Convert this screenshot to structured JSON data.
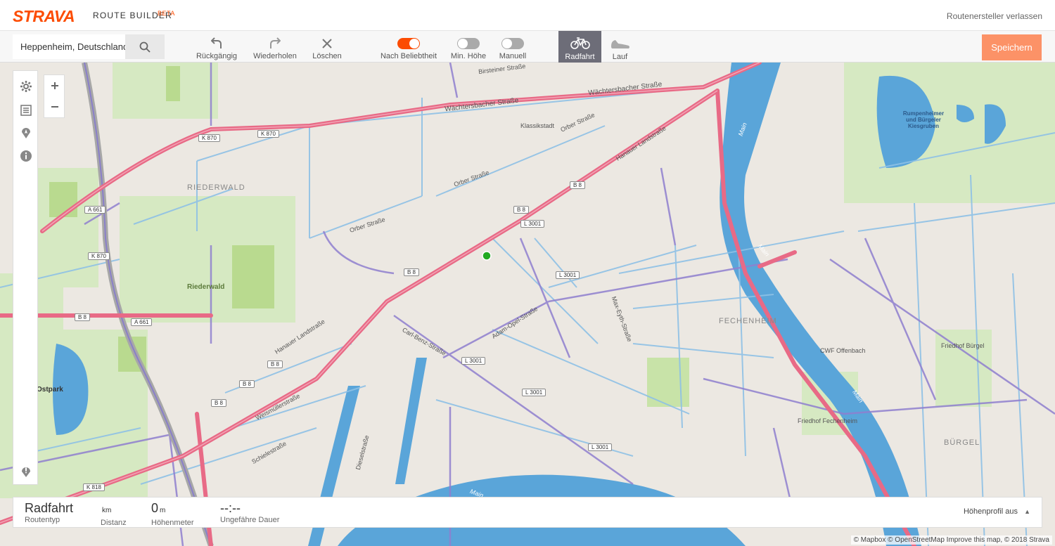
{
  "header": {
    "logo": "STRAVA",
    "title": "ROUTE BUILDER",
    "beta": "BETA",
    "exit": "Routenersteller verlassen"
  },
  "toolbar": {
    "search_value": "Heppenheim, Deutschland",
    "undo": "Rückgängig",
    "redo": "Wiederholen",
    "clear": "Löschen",
    "popularity": "Nach Beliebtheit",
    "min_elevation": "Min. Höhe",
    "manual": "Manuell",
    "ride": "Radfahrt",
    "run": "Lauf",
    "save": "Speichern",
    "popularity_on": true,
    "min_elevation_on": false,
    "manual_on": false,
    "accent": "#fc4c02"
  },
  "map": {
    "labels": {
      "riederwald_district": "RIEDERWALD",
      "riederwald": "Riederwald",
      "fechenheim": "FECHENHEIM",
      "buergel": "BÜRGEL",
      "ostpark": "Ostpark",
      "klassikstadt": "Klassikstadt",
      "lake": "Rumpenheimer und Bürgeler Kiesgruben",
      "cemetery": "Friedhof Fechenheim",
      "cemetery2": "Friedhof Bürgel",
      "cwf": "CWF Offenbach",
      "wachtersbacher": "Wächtersbacher Straße",
      "wachtersbacher2": "Wächtersbacher Straße",
      "hanauer": "Hanauer Landstraße",
      "hanauer2": "Hanauer Landstraße",
      "orber": "Orber Straße",
      "orber2": "Orber Straße",
      "orber3": "Orber Straße",
      "adam_opel": "Adam-Opel-Straße",
      "carl_benz": "Carl-Benz-Straße",
      "max_eyth": "Max-Eyth-Straße",
      "birsteiner": "Birsteiner Straße",
      "weismueller": "Weismüllerstraße",
      "schiele": "Schielestraße",
      "diesel": "Dieselstraße",
      "main1": "Main",
      "main2": "Main",
      "main3": "Main",
      "main4": "Main"
    },
    "roads": {
      "k870a": "K 870",
      "k870b": "K 870",
      "k870c": "K 870",
      "a661a": "A 661",
      "a661b": "A 661",
      "b8a": "B 8",
      "b8b": "B 8",
      "b8c": "B 8",
      "b8d": "B 8",
      "b8e": "B 8",
      "b8f": "B 8",
      "b8g": "B 8",
      "b8h": "B 8",
      "l3001a": "L 3001",
      "l3001b": "L 3001",
      "l3001c": "L 3001",
      "l3001d": "L 3001",
      "l3001e": "L 3001",
      "k818": "K 818"
    }
  },
  "stats": {
    "route_type_value": "Radfahrt",
    "route_type_label": "Routentyp",
    "distance_unit": "km",
    "distance_label": "Distanz",
    "elevation_value": "0",
    "elevation_unit": "m",
    "elevation_label": "Höhenmeter",
    "duration_value": "--:--",
    "duration_label": "Ungefähre Dauer",
    "elevation_profile": "Höhenprofil aus"
  },
  "attribution": "© Mapbox © OpenStreetMap Improve this map, © 2018 Strava"
}
